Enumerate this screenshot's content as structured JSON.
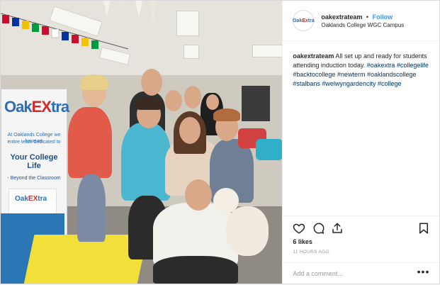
{
  "post": {
    "account": "oakextrateam",
    "separator": "•",
    "follow_label": "Follow",
    "location": "Oaklands College WGC Campus",
    "avatar_logo": {
      "pre": "Oak",
      "ex": "Ex",
      "post": "tra"
    },
    "photo": {
      "banner_brand": {
        "pre": "Oak",
        "ex": "EX",
        "post": "tra"
      },
      "banner_line1": "At Oaklands College we have an",
      "banner_line2": "entire team dedicated to",
      "banner_big": "Your College Life",
      "banner_sub": "- Beyond the Classroom",
      "panel_brand": {
        "pre": "Oak",
        "ex": "EX",
        "post": "tra"
      }
    },
    "caption": {
      "user": "oakextrateam",
      "text": "All set up and ready for students attending induction today.",
      "hashtags": [
        "#oakextra",
        "#collegelife",
        "#backtocollege",
        "#newterm",
        "#oaklandscollege",
        "#stalbans",
        "#welwyngardencity",
        "#college"
      ]
    },
    "likes": "6 likes",
    "timestamp": "11 HOURS AGO",
    "comment_placeholder": "Add a comment...",
    "more_options": "•••"
  },
  "icons": [
    "heart-icon",
    "comment-icon",
    "share-icon",
    "bookmark-icon"
  ]
}
